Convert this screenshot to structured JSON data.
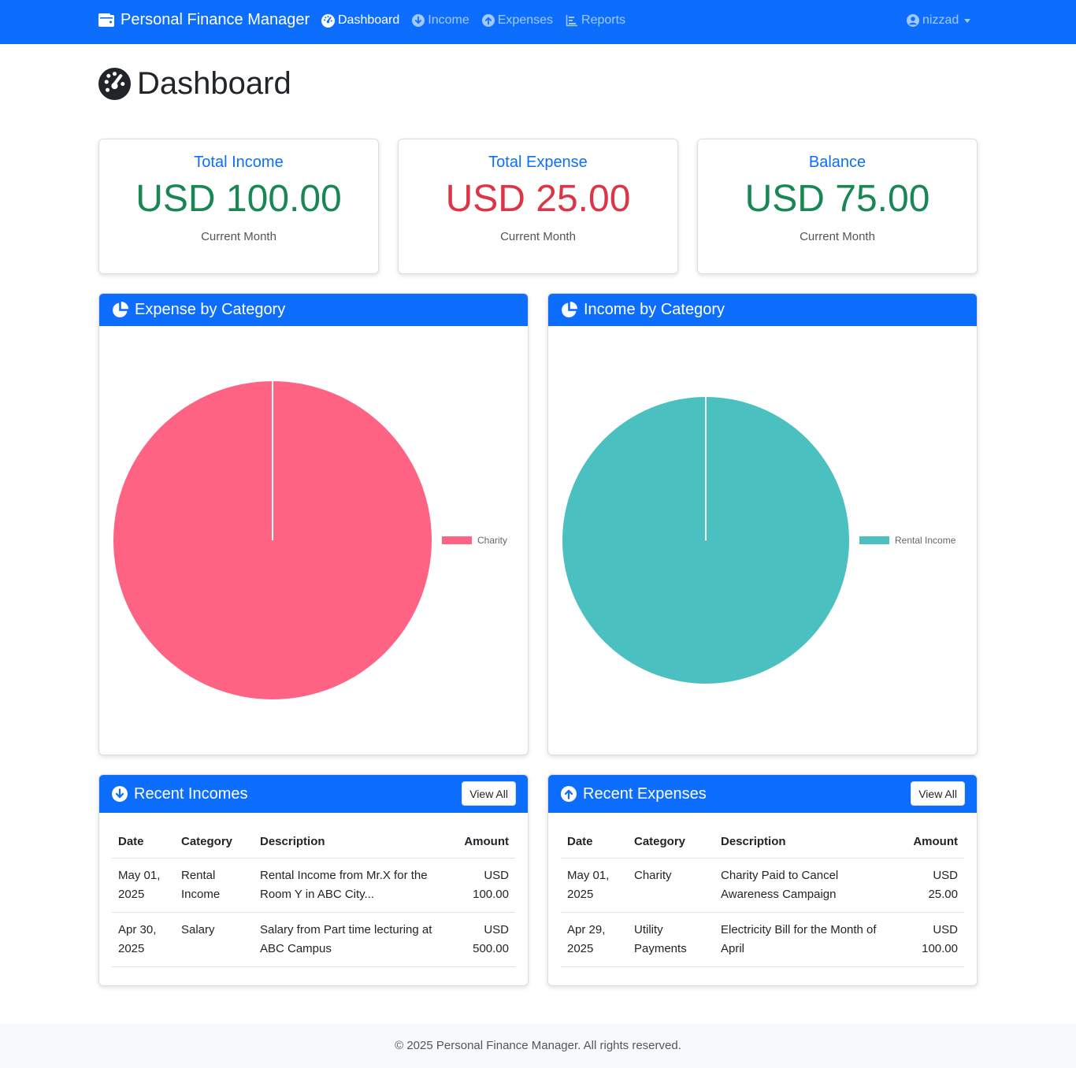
{
  "navbar": {
    "brand": "Personal Finance Manager",
    "items": [
      {
        "label": "Dashboard",
        "icon": "tachometer-icon",
        "active": true
      },
      {
        "label": "Income",
        "icon": "arrow-circle-down-icon",
        "active": false
      },
      {
        "label": "Expenses",
        "icon": "arrow-circle-up-icon",
        "active": false
      },
      {
        "label": "Reports",
        "icon": "chart-bar-icon",
        "active": false
      }
    ],
    "user": "nizzad"
  },
  "page_title": "Dashboard",
  "stats": [
    {
      "label": "Total Income",
      "value": "USD 100.00",
      "sub": "Current Month",
      "color": "#198754"
    },
    {
      "label": "Total Expense",
      "value": "USD 25.00",
      "sub": "Current Month",
      "color": "#dc3545"
    },
    {
      "label": "Balance",
      "value": "USD 75.00",
      "sub": "Current Month",
      "color": "#198754"
    }
  ],
  "expense_panel": {
    "title": "Expense by Category"
  },
  "income_panel": {
    "title": "Income by Category"
  },
  "chart_data": [
    {
      "type": "pie",
      "title": "Expense by Category",
      "categories": [
        "Charity"
      ],
      "values": [
        25.0
      ],
      "colors": [
        "#ff6384"
      ],
      "legend": "right"
    },
    {
      "type": "pie",
      "title": "Income by Category",
      "categories": [
        "Rental Income"
      ],
      "values": [
        100.0
      ],
      "colors": [
        "#4bc0c0"
      ],
      "legend": "right"
    }
  ],
  "recent_incomes": {
    "title": "Recent Incomes",
    "view_all": "View All",
    "columns": [
      "Date",
      "Category",
      "Description",
      "Amount"
    ],
    "rows": [
      {
        "date": "May 01, 2025",
        "category": "Rental Income",
        "description": "Rental Income from Mr.X for the Room Y in ABC City...",
        "amount": "USD 100.00"
      },
      {
        "date": "Apr 30, 2025",
        "category": "Salary",
        "description": "Salary from Part time lecturing at ABC Campus",
        "amount": "USD 500.00"
      }
    ]
  },
  "recent_expenses": {
    "title": "Recent Expenses",
    "view_all": "View All",
    "columns": [
      "Date",
      "Category",
      "Description",
      "Amount"
    ],
    "rows": [
      {
        "date": "May 01, 2025",
        "category": "Charity",
        "description": "Charity Paid to Cancel Awareness Campaign",
        "amount": "USD 25.00"
      },
      {
        "date": "Apr 29, 2025",
        "category": "Utility Payments",
        "description": "Electricity Bill for the Month of April",
        "amount": "USD 100.00"
      }
    ]
  },
  "footer": "© 2025 Personal Finance Manager. All rights reserved."
}
